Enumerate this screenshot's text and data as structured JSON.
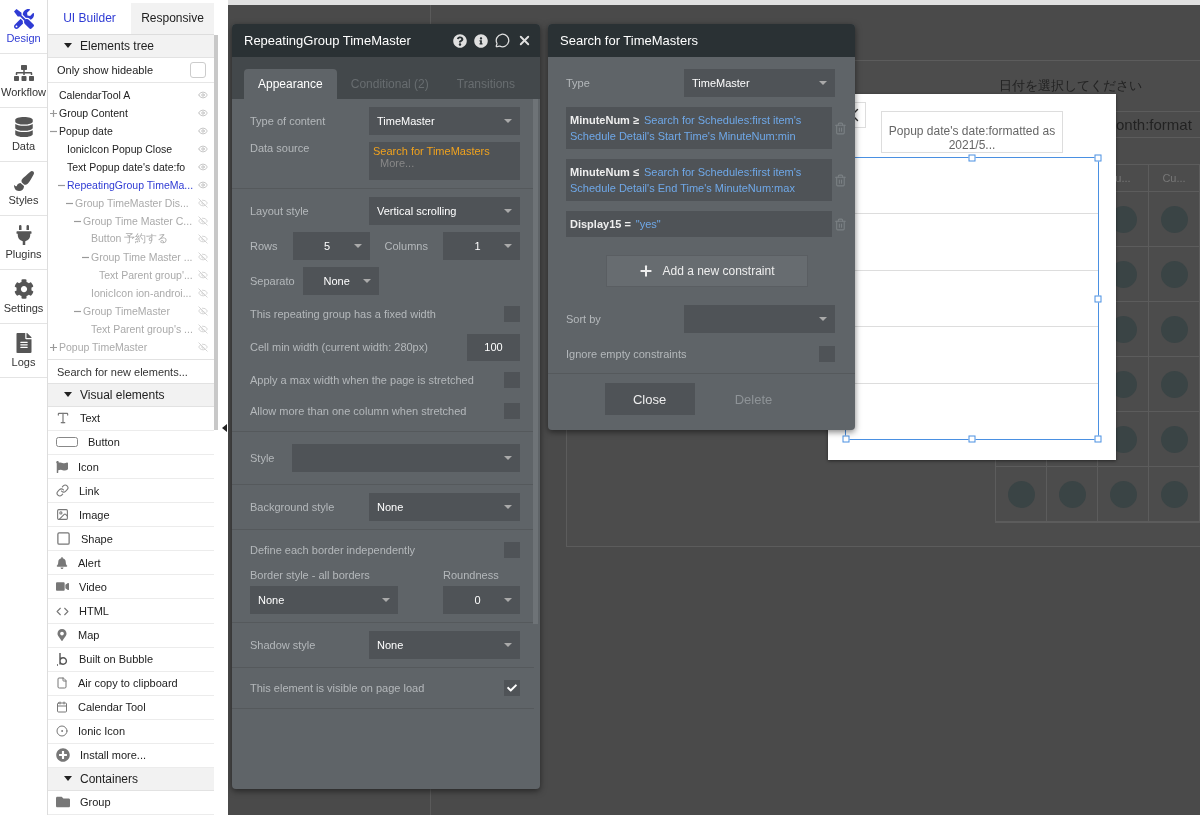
{
  "rail": [
    {
      "label": "Design",
      "selected": true
    },
    {
      "label": "Workflow",
      "selected": false
    },
    {
      "label": "Data",
      "selected": false
    },
    {
      "label": "Styles",
      "selected": false
    },
    {
      "label": "Plugins",
      "selected": false
    },
    {
      "label": "Settings",
      "selected": false
    },
    {
      "label": "Logs",
      "selected": false
    }
  ],
  "panel_tabs": [
    {
      "label": "UI Builder",
      "selected": true
    },
    {
      "label": "Responsive",
      "selected": false
    }
  ],
  "elements_tree": {
    "title": "Elements tree",
    "expanded": true,
    "hideable_label": "Only show hideable",
    "hideable_checked": false,
    "items": [
      {
        "label": "CalendarTool A",
        "hidden": false,
        "selected": false
      },
      {
        "label": "Group Content",
        "hidden": false,
        "selected": false,
        "expanded": false
      },
      {
        "label": "Popup date",
        "hidden": false,
        "selected": false,
        "expanded": true,
        "children": [
          {
            "label": "IonicIcon Popup Close",
            "hidden": false,
            "selected": false
          },
          {
            "label": "Text Popup date's date:fo",
            "hidden": false,
            "selected": false
          },
          {
            "label": "RepeatingGroup TimeMa...",
            "hidden": false,
            "selected": true,
            "expanded": true,
            "children": [
              {
                "label": "Group TimeMaster Dis...",
                "hidden": true,
                "selected": false,
                "expanded": true,
                "children": [
                  {
                    "label": "Group Time Master C...",
                    "hidden": true,
                    "selected": false,
                    "expanded": true,
                    "children": [
                      {
                        "label": "Button 予約する",
                        "hidden": true,
                        "selected": false
                      },
                      {
                        "label": "Group Time Master ...",
                        "hidden": true,
                        "selected": false,
                        "expanded": true,
                        "children": [
                          {
                            "label": "Text Parent group'...",
                            "hidden": true,
                            "selected": false
                          }
                        ]
                      },
                      {
                        "label": "IonicIcon ion-androi...",
                        "hidden": true,
                        "selected": false
                      }
                    ]
                  },
                  {
                    "label": "Group TimeMaster",
                    "hidden": true,
                    "selected": false,
                    "expanded": true,
                    "children": [
                      {
                        "label": "Text Parent group's ...",
                        "hidden": true,
                        "selected": false
                      }
                    ]
                  }
                ]
              }
            ]
          }
        ]
      },
      {
        "label": "Popup TimeMaster",
        "hidden": true,
        "selected": false,
        "expanded": false
      }
    ]
  },
  "element_search": {
    "placeholder": "Search for new elements..."
  },
  "visual_elements": {
    "title": "Visual elements",
    "expanded": true,
    "items": [
      "Text",
      "Button",
      "Icon",
      "Link",
      "Image",
      "Shape",
      "Alert",
      "Video",
      "HTML",
      "Map",
      "Built on Bubble",
      "Air copy to clipboard",
      "Calendar Tool",
      "Ionic Icon",
      "Install more..."
    ]
  },
  "containers": {
    "title": "Containers",
    "expanded": true,
    "items": [
      "Group"
    ]
  },
  "property_editor": {
    "title": "RepeatingGroup TimeMaster",
    "tabs": [
      {
        "label": "Appearance",
        "selected": true
      },
      {
        "label": "Conditional (2)",
        "selected": false
      },
      {
        "label": "Transitions",
        "selected": false
      }
    ],
    "sections": [
      [
        {
          "kind": "select",
          "label": "Type of content",
          "value": "TimeMaster"
        },
        {
          "kind": "source",
          "label": "Data source",
          "value": "Search for TimeMasters",
          "more": "More..."
        }
      ],
      [
        {
          "kind": "select",
          "label": "Layout style",
          "value": "Vertical scrolling"
        },
        {
          "kind": "pair",
          "label": "Rows",
          "value": "5",
          "label2": "Columns",
          "value2": "1"
        },
        {
          "kind": "small",
          "label": "Separato",
          "value": "None"
        },
        {
          "kind": "checkbox",
          "label": "This repeating group has a fixed width",
          "checked": false
        },
        {
          "kind": "input",
          "label": "Cell min width (current width: 280px)",
          "value": "100"
        },
        {
          "kind": "checkbox",
          "label": "Apply a max width when the page is stretched",
          "checked": false
        },
        {
          "kind": "checkbox",
          "label": "Allow more than one column when stretched",
          "checked": false
        }
      ],
      [
        {
          "kind": "wide",
          "label": "Style"
        }
      ],
      [
        {
          "kind": "select",
          "label": "Background style",
          "value": "None"
        }
      ],
      [
        {
          "kind": "checkbox",
          "label": "Define each border independently",
          "checked": false
        },
        {
          "kind": "border",
          "label": "Border style - all borders",
          "value": "None",
          "label2": "Roundness",
          "value2": "0"
        }
      ],
      [
        {
          "kind": "select",
          "label": "Shadow style",
          "value": "None"
        }
      ],
      [
        {
          "kind": "checkbox",
          "label": "This element is visible on page load",
          "checked": true
        }
      ]
    ]
  },
  "search_panel": {
    "title": "Search for TimeMasters",
    "type_label": "Type",
    "type_value": "TimeMaster",
    "constraints": [
      {
        "field": "MinuteNum ≥",
        "value": "Search for Schedules:first item's Schedule Detail's Start Time's MinuteNum:min"
      },
      {
        "field": "MinuteNum ≤",
        "value": "Search for Schedules:first item's Schedule Detail's End Time's MinuteNum:max"
      },
      {
        "field": "Display15 =",
        "value": "\"yes\""
      }
    ],
    "add_label": "Add a new constraint",
    "sort_label": "Sort by",
    "ignore_label": "Ignore empty constraints",
    "ignore_checked": false,
    "buttons": [
      {
        "label": "Close",
        "disabled": false
      },
      {
        "label": "Delete",
        "disabled": true
      }
    ]
  },
  "page": {
    "title": "日付を選択してください",
    "subtitle": "onth:format",
    "headers": [
      "u...",
      "Cu..."
    ]
  },
  "popup": {
    "text": "Popup date's date:formatted as 2021/5..."
  }
}
